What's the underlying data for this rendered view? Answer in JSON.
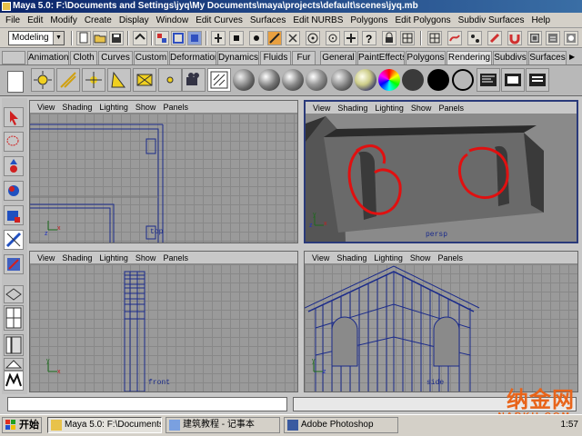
{
  "window": {
    "title": "Maya 5.0: F:\\Documents and Settings\\jyq\\My Documents\\maya\\projects\\default\\scenes\\jyq.mb"
  },
  "menu": [
    "File",
    "Edit",
    "Modify",
    "Create",
    "Display",
    "Window",
    "Edit Curves",
    "Surfaces",
    "Edit NURBS",
    "Polygons",
    "Edit Polygons",
    "Subdiv Surfaces",
    "Help"
  ],
  "statusline": {
    "mode": "Modeling"
  },
  "shelf_tabs": [
    "Animation",
    "Cloth",
    "Curves",
    "Custom",
    "Deformation",
    "Dynamics",
    "Fluids",
    "Fur",
    "General",
    "PaintEffects",
    "Polygons",
    "Rendering",
    "Subdivs",
    "Surfaces"
  ],
  "active_shelf_tab": "Rendering",
  "viewport_menu": [
    "View",
    "Shading",
    "Lighting",
    "Show",
    "Panels"
  ],
  "viewports": {
    "top": {
      "label": "top"
    },
    "persp": {
      "label": "persp"
    },
    "front": {
      "label": "front"
    },
    "side": {
      "label": "side"
    }
  },
  "axis": {
    "x": "x",
    "y": "y",
    "z": "z"
  },
  "taskbar": {
    "start": "开始",
    "items": [
      "Maya 5.0: F:\\Documents...",
      "建筑教程 - 记事本",
      "Adobe Photoshop"
    ],
    "clock": "1:57"
  },
  "watermark": {
    "main": "纳金网",
    "sub": "NARKII.COM"
  },
  "colors": {
    "accent": "#2a3a7a",
    "wire": "#1a2a8a",
    "annotation": "#e01010"
  }
}
